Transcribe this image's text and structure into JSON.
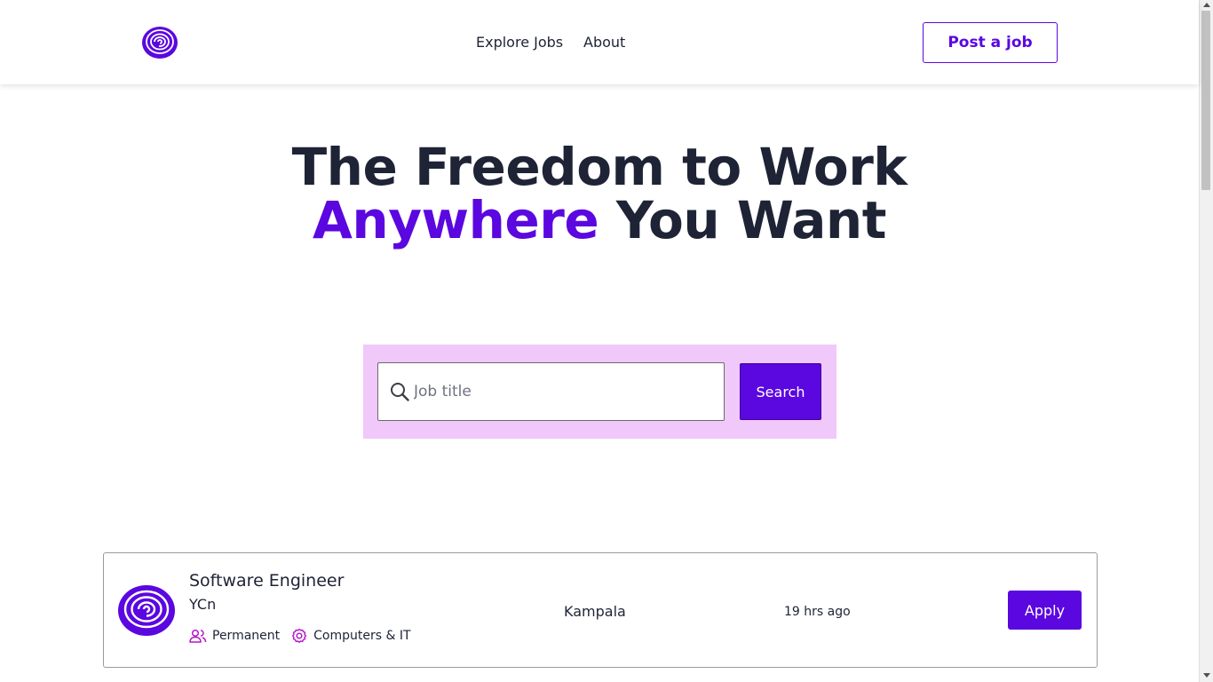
{
  "header": {
    "nav": [
      {
        "label": "Explore Jobs"
      },
      {
        "label": "About"
      }
    ],
    "post_job_label": "Post a job"
  },
  "hero": {
    "line1": "The Freedom to Work",
    "line2_accent": "Anywhere",
    "line2_rest": "You Want"
  },
  "search": {
    "placeholder": "Job title",
    "button_label": "Search"
  },
  "jobs": [
    {
      "title": "Software Engineer",
      "company": "YCn",
      "type": "Permanent",
      "category": "Computers & IT",
      "location": "Kampala",
      "posted": "19 hrs ago",
      "apply_label": "Apply"
    }
  ],
  "colors": {
    "accent": "#5b07e0",
    "search_panel_bg": "#f0c8fa",
    "text": "#1e2335",
    "tag_icon": "#b316c9"
  },
  "icons": {
    "logo": "spiral-logo-icon",
    "search": "magnifier-icon",
    "type": "users-icon",
    "category": "gear-icon"
  }
}
